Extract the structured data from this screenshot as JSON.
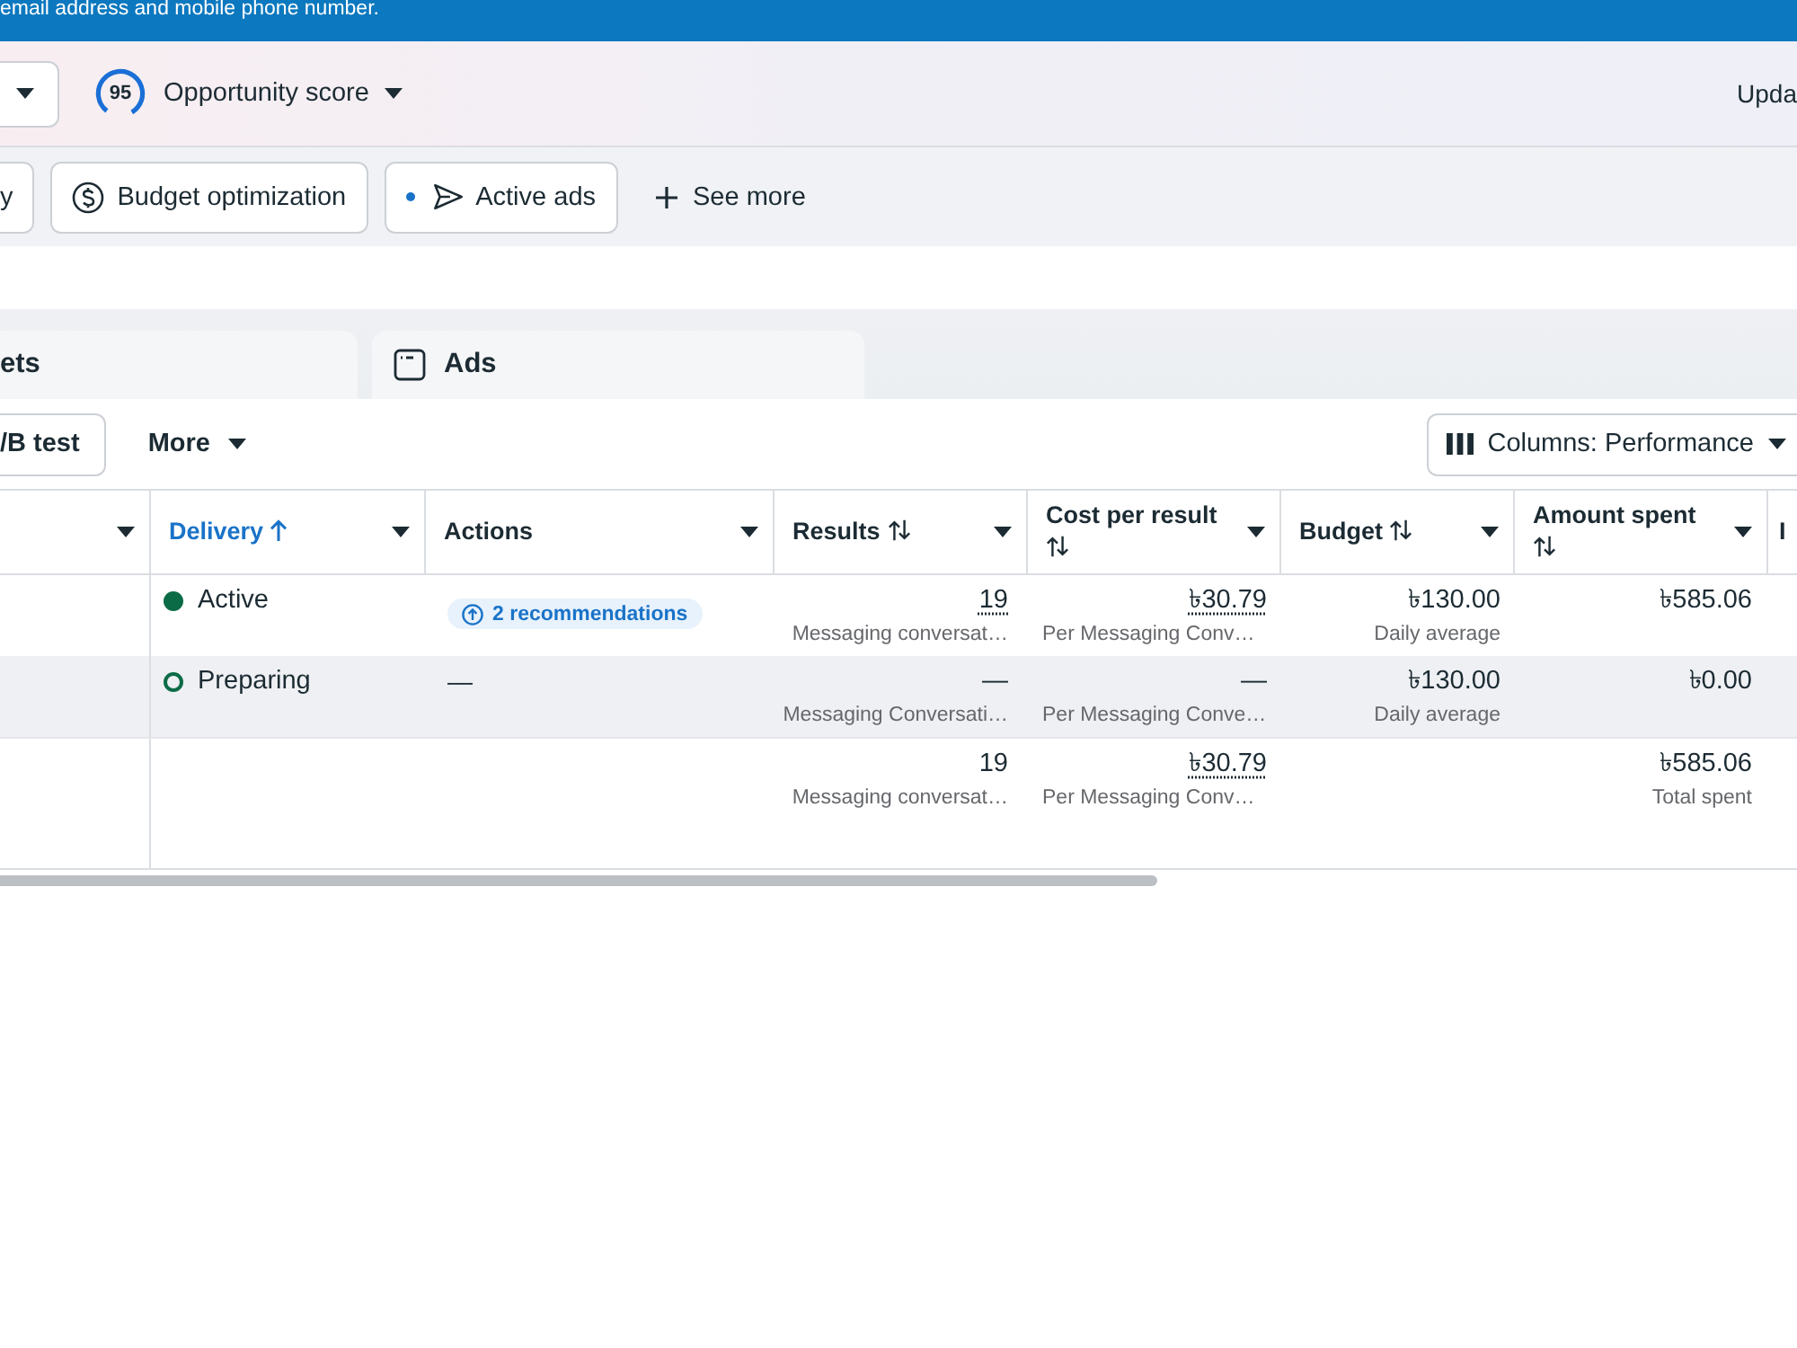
{
  "banner": {
    "text": "email address and mobile phone number."
  },
  "summary_bar": {
    "score": "95",
    "score_label": "Opportunity score",
    "update_text": "Upda"
  },
  "filters": {
    "chips": [
      {
        "label": "y",
        "kind": "plain",
        "dot": false
      },
      {
        "label": "Budget optimization",
        "kind": "budget",
        "dot": false
      },
      {
        "label": "Active ads",
        "kind": "delivery",
        "dot": true
      }
    ],
    "see_more": "See more"
  },
  "level_tabs": [
    {
      "label": "ets",
      "kind": "plain",
      "selected": false
    },
    {
      "label": "Ads",
      "kind": "with_icon",
      "selected": false
    }
  ],
  "toolbar": {
    "buttons": [
      {
        "label": "/B test",
        "kind": "outlined"
      },
      {
        "label": "More",
        "kind": "menu"
      }
    ],
    "columns_button": "Columns: Performance"
  },
  "table": {
    "columns": [
      {
        "label": "Delivery",
        "kind": "sorted_up"
      },
      {
        "label": "Actions",
        "kind": "plain"
      },
      {
        "label": "Results",
        "kind": "sortable"
      },
      {
        "label": "Cost per result",
        "kind": "sortable"
      },
      {
        "label": "Budget",
        "kind": "sortable"
      },
      {
        "label": "Amount spent",
        "kind": "sortable"
      },
      {
        "label": "I",
        "kind": "plain"
      }
    ],
    "rows": [
      {
        "highlighted": false,
        "delivery": {
          "status": "Active",
          "kind": "active"
        },
        "actions": {
          "kind": "recommendations",
          "text": "2 recommendations"
        },
        "results": {
          "value": "19",
          "dotted": true,
          "caption": "Messaging conversat…"
        },
        "cost_per_result": {
          "value": "৳30.79",
          "dotted": true,
          "caption": "Per Messaging Conv…"
        },
        "budget": {
          "value": "৳130.00",
          "dotted": false,
          "caption": "Daily average"
        },
        "amount_spent": {
          "value": "৳585.06",
          "dotted": false
        }
      },
      {
        "highlighted": true,
        "delivery": {
          "status": "Preparing",
          "kind": "preparing"
        },
        "actions": {
          "kind": "text",
          "text": "—"
        },
        "results": {
          "value": "—",
          "dotted": false,
          "caption": "Messaging Conversati…"
        },
        "cost_per_result": {
          "value": "—",
          "dotted": false,
          "caption": "Per Messaging Conve…"
        },
        "budget": {
          "value": "৳130.00",
          "dotted": false,
          "caption": "Daily average"
        },
        "amount_spent": {
          "value": "৳0.00",
          "dotted": false
        }
      }
    ],
    "summary": {
      "results": {
        "value": "19",
        "dotted": false,
        "caption": "Messaging conversat…"
      },
      "cost_per_result": {
        "value": "৳30.79",
        "dotted": true,
        "caption": "Per Messaging Conv…"
      },
      "amount_spent": {
        "value": "৳585.06",
        "dotted": false,
        "caption": "Total spent"
      }
    }
  }
}
